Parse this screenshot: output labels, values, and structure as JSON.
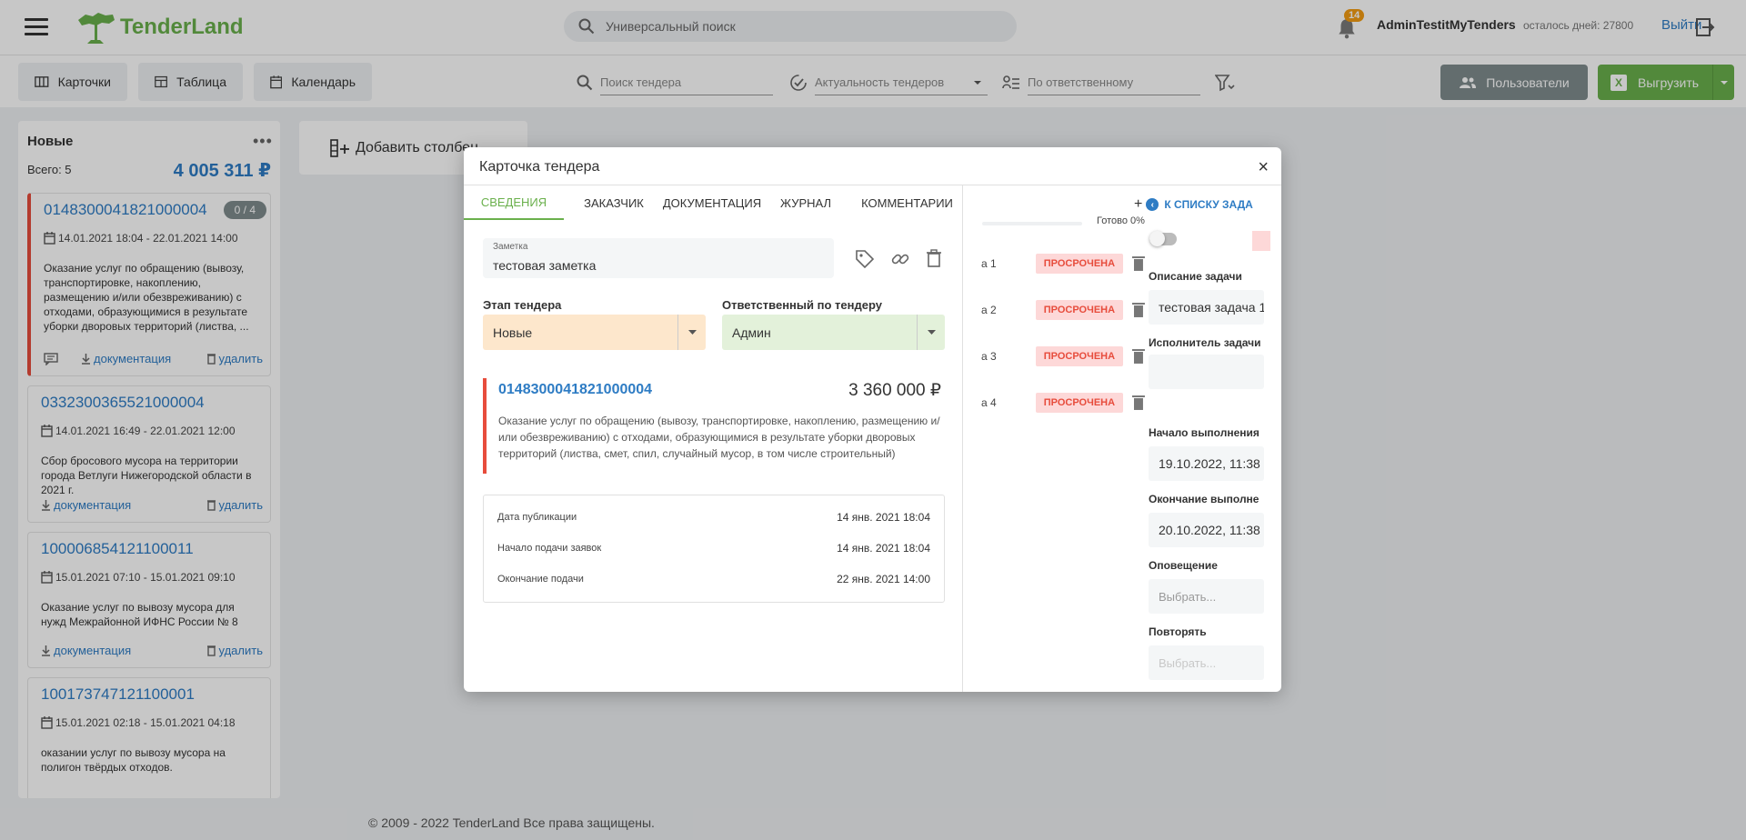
{
  "header": {
    "logo_text": "TenderLand",
    "search_placeholder": "Универсальный поиск",
    "notifications_count": "14",
    "username": "AdminTestitMyTenders",
    "days_left": "осталось дней: 27800",
    "logout": "Выйти"
  },
  "toolbar": {
    "views": [
      {
        "label": "Карточки",
        "icon": "cards-icon"
      },
      {
        "label": "Таблица",
        "icon": "table-icon"
      },
      {
        "label": "Календарь",
        "icon": "calendar-icon"
      }
    ],
    "search_tender_placeholder": "Поиск тендера",
    "relevance_placeholder": "Актуальность тендеров",
    "responsible_placeholder": "По ответственному",
    "users_button": "Пользователи",
    "export_button": "Выгрузить"
  },
  "board": {
    "column": {
      "title": "Новые",
      "total": "Всего: 5",
      "sum": "4 005 311 ₽",
      "menu": "•••"
    },
    "cards": [
      {
        "number": "0148300041821000004",
        "badge": "0 / 4",
        "dates": "14.01.2021 18:04 - 22.01.2021 14:00",
        "description": "Оказание услуг по обращению (вывозу, транспортировке, накоплению, размещению и/или обезвреживанию) с отходами, образующимися в результате уборки дворовых территорий (листва, ...",
        "docs": "документация",
        "delete": "удалить"
      },
      {
        "number": "0332300365521000004",
        "dates": "14.01.2021 16:49 - 22.01.2021 12:00",
        "description": "Сбор бросового мусора на территории города Ветлуги Нижегородской области в 2021 г.",
        "docs": "документация",
        "delete": "удалить"
      },
      {
        "number": "100006854121100011",
        "dates": "15.01.2021 07:10 - 15.01.2021 09:10",
        "description": "Оказание услуг по вывозу мусора для нужд Межрайонной ИФНС России № 8",
        "docs": "документация",
        "delete": "удалить"
      },
      {
        "number": "100173747121100001",
        "dates": "15.01.2021 02:18 - 15.01.2021 04:18",
        "description": "оказании услуг по вывозу мусора на полигон твёрдых отходов."
      }
    ],
    "add_column": "Добавить столбец"
  },
  "footer": "© 2009 - 2022 TenderLand Все права защищены.",
  "modal": {
    "title": "Карточка тендера",
    "close": "×",
    "tabs": [
      "Сведения",
      "Заказчик",
      "Документация",
      "Журнал",
      "Комментарии"
    ],
    "note": {
      "label": "Заметка",
      "value": "тестовая заметка"
    },
    "stage": {
      "label": "Этап тендера",
      "value": "Новые"
    },
    "responsible": {
      "label": "Ответственный по тендеру",
      "value": "Админ"
    },
    "tender": {
      "number": "0148300041821000004",
      "price": "3 360 000 ₽",
      "description": "Оказание услуг по обращению (вывозу, транспортировке, накоплению, размещению и/или обезвреживанию) с отходами, образующимися в результате уборки дворовых территорий (листва, смет, спил, случайный мусор, в том числе строительный)"
    },
    "dates": [
      {
        "label": "Дата публикации",
        "value": "14 янв. 2021 18:04"
      },
      {
        "label": "Начало подачи заявок",
        "value": "14 янв. 2021 18:04"
      },
      {
        "label": "Окончание подачи",
        "value": "22 янв. 2021 14:00"
      }
    ],
    "tasks_panel": {
      "back_link": "К СПИСКУ ЗАДА",
      "ready": "Готово 0%",
      "tasks": [
        {
          "name": "а 1",
          "status": "ПРОСРОЧЕНА"
        },
        {
          "name": "а 2",
          "status": "ПРОСРОЧЕНА"
        },
        {
          "name": "а 3",
          "status": "ПРОСРОЧЕНА"
        },
        {
          "name": "а 4",
          "status": "ПРОСРОЧЕНА"
        }
      ],
      "desc_label": "Описание задачи",
      "desc_value": "тестовая задача 1",
      "executor_label": "Исполнитель задачи",
      "start_label": "Начало выполнения",
      "start_value": "19.10.2022, 11:38",
      "end_label": "Окончание выполне",
      "end_value": "20.10.2022, 11:38",
      "notify_label": "Оповещение",
      "notify_placeholder": "Выбрать...",
      "repeat_label": "Повторять",
      "repeat_placeholder": "Выбрать..."
    }
  },
  "colors": {
    "brand_green": "#6ab04c",
    "link_blue": "#2e7cc4",
    "danger_red": "#e74c3c",
    "stage_bg": "#fde7cc",
    "responsible_bg": "#e3f1da"
  }
}
